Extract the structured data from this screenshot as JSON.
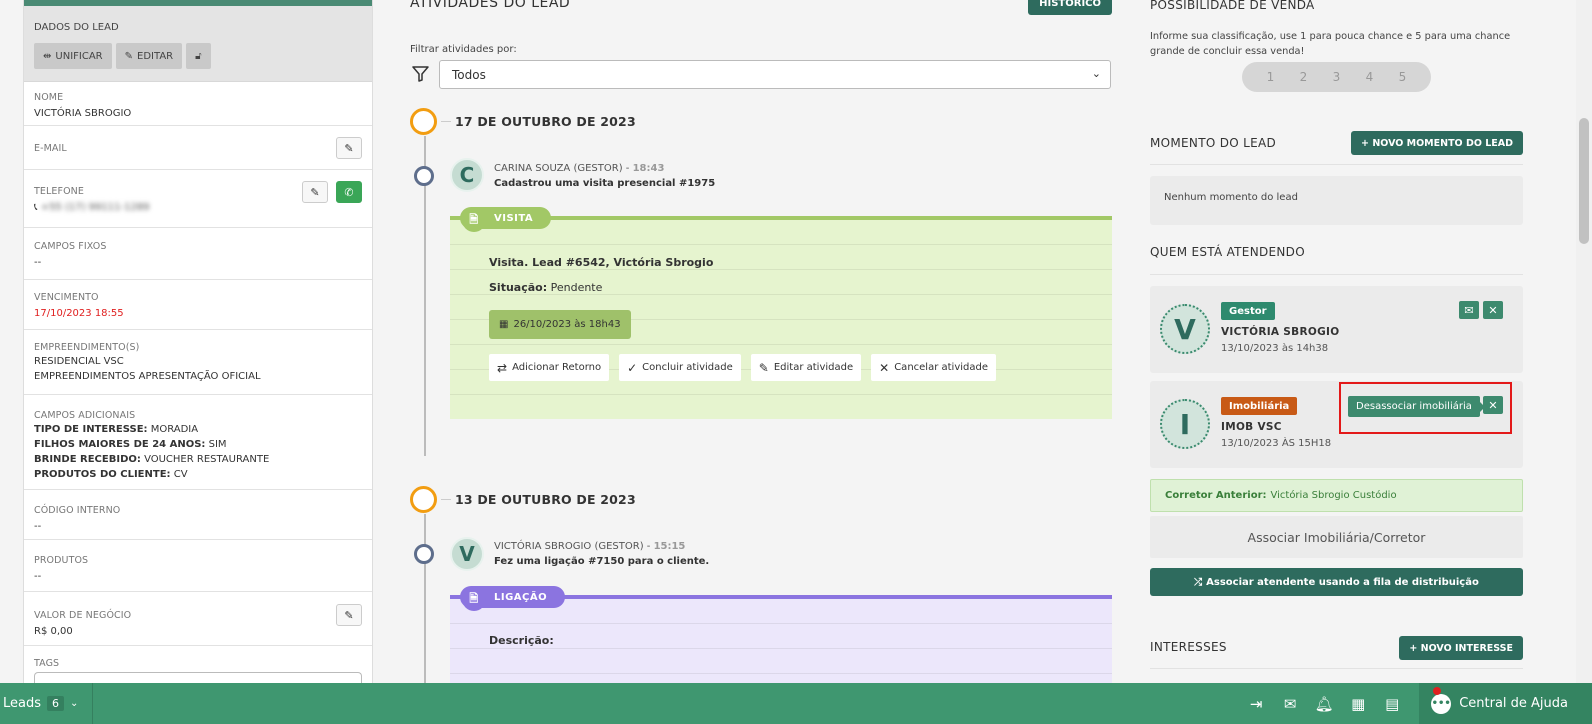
{
  "left": {
    "header": {
      "title": "DADOS DO LEAD",
      "unify_label": "UNIFICAR",
      "edit_label": "EDITAR"
    },
    "fields": {
      "nome": {
        "label": "NOME",
        "value": "VICTÓRIA SBROGIO"
      },
      "email": {
        "label": "E-MAIL"
      },
      "telefone": {
        "label": "TELEFONE",
        "value": "+55 (17) 99111-1289"
      },
      "campos_fixos": {
        "label": "CAMPOS FIXOS",
        "value": "--"
      },
      "vencimento": {
        "label": "VENCIMENTO",
        "value": "17/10/2023 18:55"
      },
      "empreendimentos": {
        "label": "EMPREENDIMENTO(S)",
        "values": [
          "RESIDENCIAL VSC",
          "EMPREENDIMENTOS APRESENTAÇÃO OFICIAL"
        ]
      },
      "campos_adicionais": {
        "label": "CAMPOS ADICIONAIS",
        "items": [
          {
            "key": "TIPO DE INTERESSE:",
            "value": "MORADIA"
          },
          {
            "key": "FILHOS MAIORES DE 24 ANOS:",
            "value": "SIM"
          },
          {
            "key": "BRINDE RECEBIDO:",
            "value": "VOUCHER RESTAURANTE"
          },
          {
            "key": "PRODUTOS DO CLIENTE:",
            "value": "CV"
          }
        ]
      },
      "codigo_interno": {
        "label": "CÓDIGO INTERNO",
        "value": "--"
      },
      "produtos": {
        "label": "PRODUTOS",
        "value": "--"
      },
      "valor_negocio": {
        "label": "VALOR DE NEGÓCIO",
        "value": "R$ 0,00"
      },
      "tags": {
        "label": "TAGS"
      }
    }
  },
  "center": {
    "title": "ATIVIDADES DO LEAD",
    "history_label": "HISTÓRICO",
    "filter_label": "Filtrar atividades por:",
    "filter_value": "Todos",
    "groups": [
      {
        "date": "17 DE OUTUBRO DE 2023",
        "activity": {
          "avatar": "C",
          "author": "CARINA SOUZA (GESTOR) - ",
          "time": "18:43",
          "desc": "Cadastrou uma visita presencial #1975",
          "tag": "VISITA",
          "title": "Visita. Lead #6542, Victória Sbrogio",
          "status_key": "Situação:",
          "status_value": "Pendente",
          "date_pill": "26/10/2023 às 18h43",
          "buttons": [
            "Adicionar Retorno",
            "Concluir atividade",
            "Editar atividade",
            "Cancelar atividade"
          ]
        }
      },
      {
        "date": "13 DE OUTUBRO DE 2023",
        "activity": {
          "avatar": "V",
          "author": "VICTÓRIA SBROGIO (GESTOR) - ",
          "time": "15:15",
          "desc": "Fez uma ligação #7150 para o cliente.",
          "tag": "LIGAÇÃO",
          "desc_label": "Descrição:"
        }
      }
    ]
  },
  "right": {
    "possibilidade": {
      "title": "POSSIBILIDADE DE VENDA",
      "help": "Informe sua classificação, use 1 para pouca chance e 5 para uma chance grande de concluir essa venda!",
      "ratings": [
        "1",
        "2",
        "3",
        "4",
        "5"
      ]
    },
    "momento": {
      "title": "MOMENTO DO LEAD",
      "button": "+ NOVO MOMENTO DO LEAD",
      "empty": "Nenhum momento do lead"
    },
    "atendendo": {
      "title": "QUEM ESTÁ ATENDENDO",
      "people": [
        {
          "avatar": "V",
          "role": "Gestor",
          "name": "VICTÓRIA SBROGIO",
          "date": "13/10/2023 às 14h38"
        },
        {
          "avatar": "I",
          "role": "Imobiliária",
          "name": "IMOB VSC",
          "date": "13/10/2023 ÀS 15H18"
        }
      ],
      "tooltip": "Desassociar imobiliária",
      "previous_key": "Corretor Anterior:",
      "previous_value": "Victória Sbrogio Custódio",
      "associate": "Associar Imobiliária/Corretor",
      "queue": "Associar atendente usando a fila de distribuição"
    },
    "interesses": {
      "title": "INTERESSES",
      "button": "+ NOVO INTERESSE"
    }
  },
  "bottom": {
    "leads_label": "Leads",
    "leads_count": "6",
    "help_label": "Central de Ajuda"
  },
  "colors": {
    "primary": "#2e6b5e",
    "bottombar": "#3f9770",
    "visit": "#a2c866",
    "call": "#8b74e0",
    "accent": "#f29d11",
    "highlight": "#e31919"
  }
}
